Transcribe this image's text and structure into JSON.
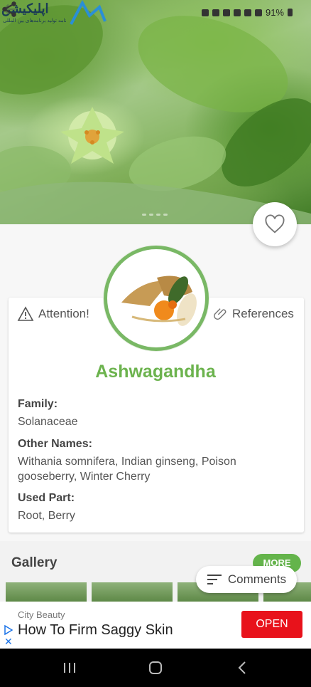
{
  "status": {
    "battery": "91%"
  },
  "watermark": {
    "text": "اپلیکیشن",
    "subtext": "نامه تولید برنامه‌های بین المللی"
  },
  "hero": {
    "dots": 4
  },
  "actions": {
    "attention": "Attention!",
    "references": "References"
  },
  "plant": {
    "name": "Ashwagandha",
    "family_label": "Family:",
    "family": "Solanaceae",
    "other_names_label": "Other Names:",
    "other_names": "Withania somnifera, Indian ginseng, Poison gooseberry, Winter Cherry",
    "used_part_label": "Used Part:",
    "used_part": "Root, Berry"
  },
  "gallery": {
    "title": "Gallery",
    "more_label": "MORE",
    "thumbnails": 4
  },
  "comments": {
    "label": "Comments"
  },
  "ad": {
    "brand": "City Beauty",
    "headline": "How To Firm Saggy Skin",
    "cta": "OPEN"
  },
  "colors": {
    "accent": "#6cb34e",
    "ad_button": "#e8121b"
  },
  "icons": {
    "back": "arrow-left-icon",
    "share": "share-icon",
    "favorite": "heart-icon",
    "attention": "warning-triangle-icon",
    "references": "paperclip-icon",
    "comments": "sort-lines-icon",
    "recent": "recent-apps-icon",
    "home": "home-icon",
    "nav_back": "nav-back-icon"
  }
}
